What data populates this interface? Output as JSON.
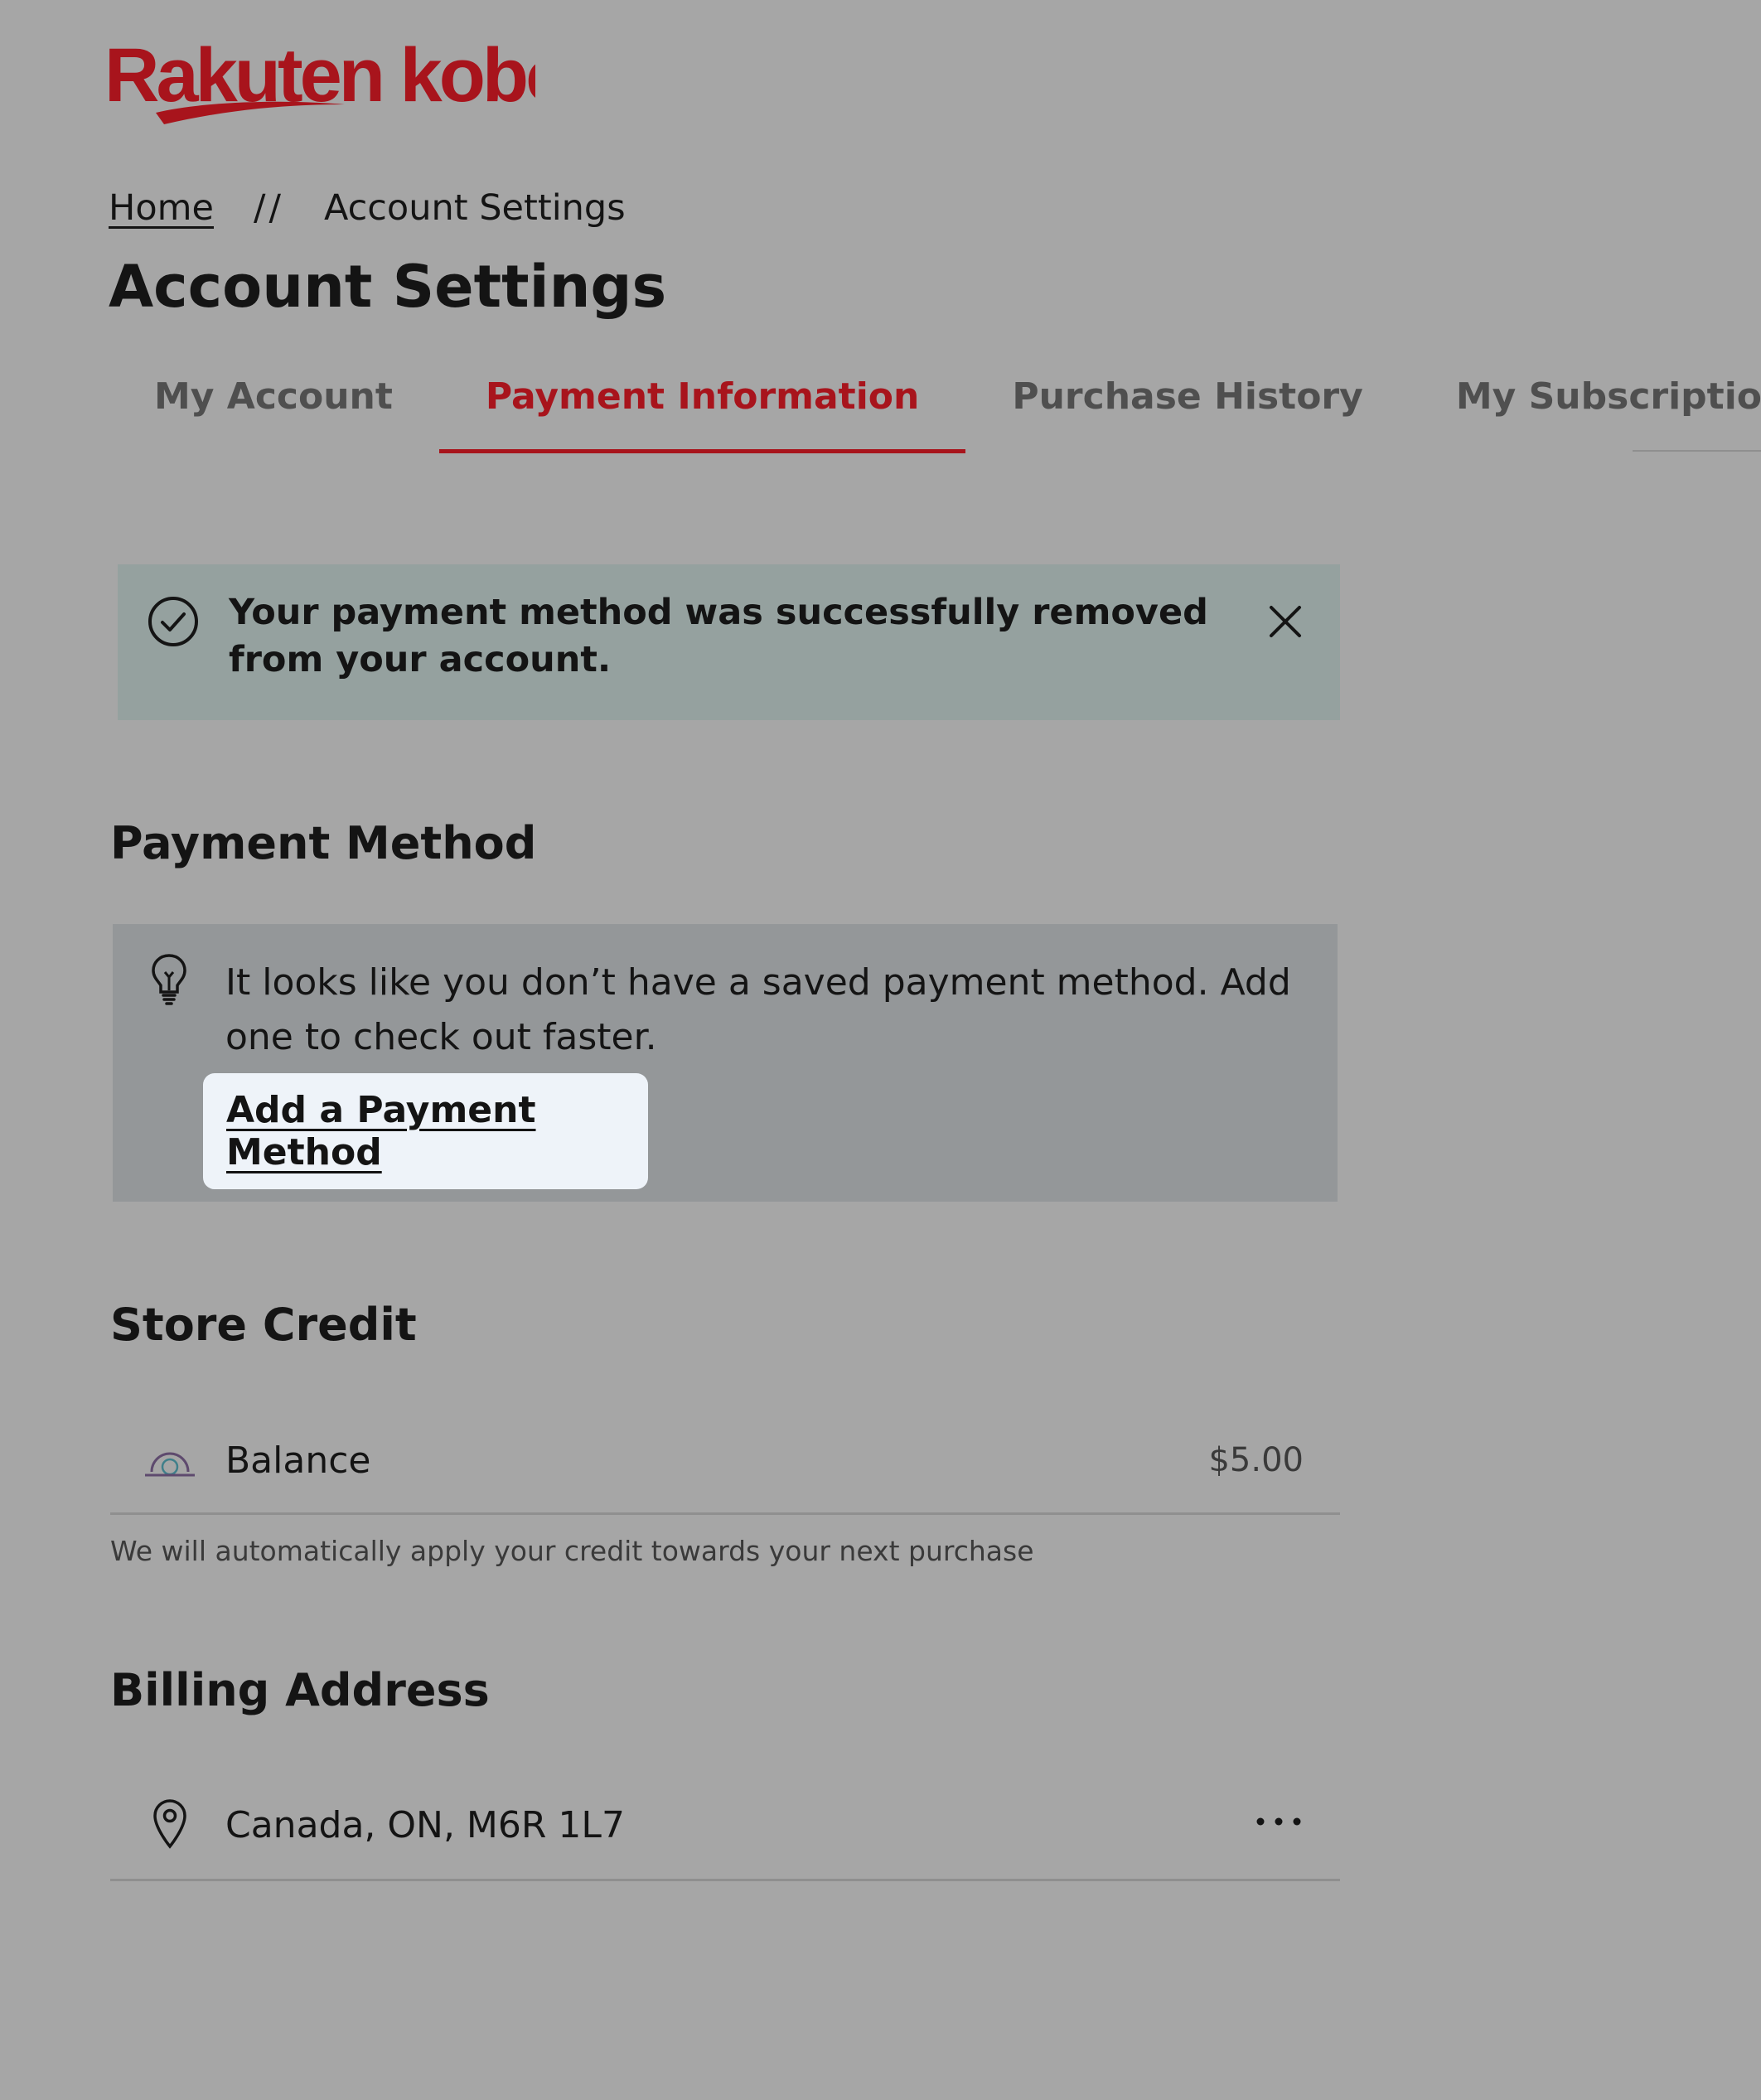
{
  "brand": {
    "logo_text": "Rakuten kobo",
    "color": "#a8141c"
  },
  "breadcrumb": {
    "home": "Home",
    "separator": "//",
    "current": "Account Settings"
  },
  "page": {
    "title": "Account Settings"
  },
  "tabs": [
    {
      "label": "My Account",
      "active": false
    },
    {
      "label": "Payment Information",
      "active": true
    },
    {
      "label": "Purchase History",
      "active": false
    },
    {
      "label": "My Subscriptions",
      "active": false
    }
  ],
  "banner": {
    "icon": "check-circle-icon",
    "message": "Your payment method was successfully removed from your account.",
    "close_icon": "close-icon"
  },
  "payment_method": {
    "heading": "Payment Method",
    "info_icon": "lightbulb-icon",
    "info_text": "It looks like you don’t have a saved payment method. Add one to check out faster.",
    "add_button": "Add a Payment Method"
  },
  "store_credit": {
    "heading": "Store Credit",
    "icon": "store-credit-icon",
    "label": "Balance",
    "value": "$5.00",
    "note": "We will automatically apply your credit towards your next purchase"
  },
  "billing": {
    "heading": "Billing Address",
    "icon": "location-pin-icon",
    "address": "Canada, ON, M6R 1L7",
    "more_icon": "more-options-icon"
  }
}
